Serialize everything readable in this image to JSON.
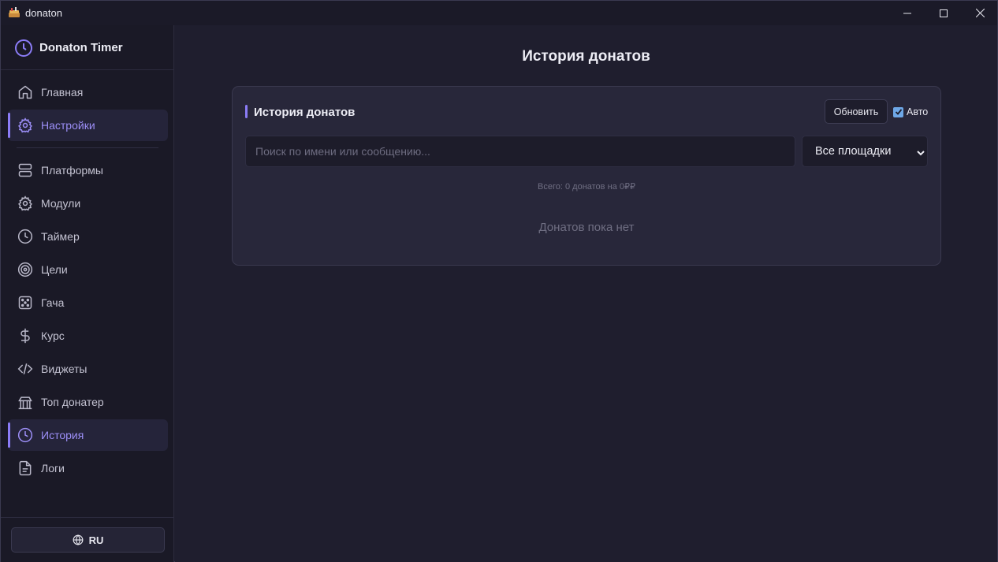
{
  "window": {
    "title": "donaton",
    "icon": "app-logo-icon"
  },
  "sidebar": {
    "brand": "Donaton Timer",
    "brand_icon": "clock-icon",
    "items": [
      {
        "label": "Главная",
        "icon": "home-icon"
      },
      {
        "label": "Настройки",
        "icon": "gear-icon"
      },
      {
        "label": "Платформы",
        "icon": "server-icon"
      },
      {
        "label": "Модули",
        "icon": "gear-icon"
      },
      {
        "label": "Таймер",
        "icon": "clock-icon"
      },
      {
        "label": "Цели",
        "icon": "target-icon"
      },
      {
        "label": "Гача",
        "icon": "dice-icon"
      },
      {
        "label": "Курс",
        "icon": "dollar-icon"
      },
      {
        "label": "Виджеты",
        "icon": "code-icon"
      },
      {
        "label": "Топ донатер",
        "icon": "podium-icon"
      },
      {
        "label": "История",
        "icon": "history-icon"
      },
      {
        "label": "Логи",
        "icon": "file-text-icon"
      }
    ],
    "language": "RU"
  },
  "main": {
    "page_title": "История донатов",
    "card": {
      "title": "История донатов",
      "refresh_label": "Обновить",
      "auto_label": "Авто",
      "auto_checked": true,
      "search_placeholder": "Поиск по имени или сообщению...",
      "search_value": "",
      "platform_selected": "Все площадки",
      "total_text": "Всего: 0 донатов на 0₽₽",
      "empty_text": "Донатов пока нет"
    }
  },
  "colors": {
    "accent": "#8b7cf6",
    "background": "#1f1e2e",
    "sidebar": "#1a1926",
    "card": "#28273a"
  }
}
